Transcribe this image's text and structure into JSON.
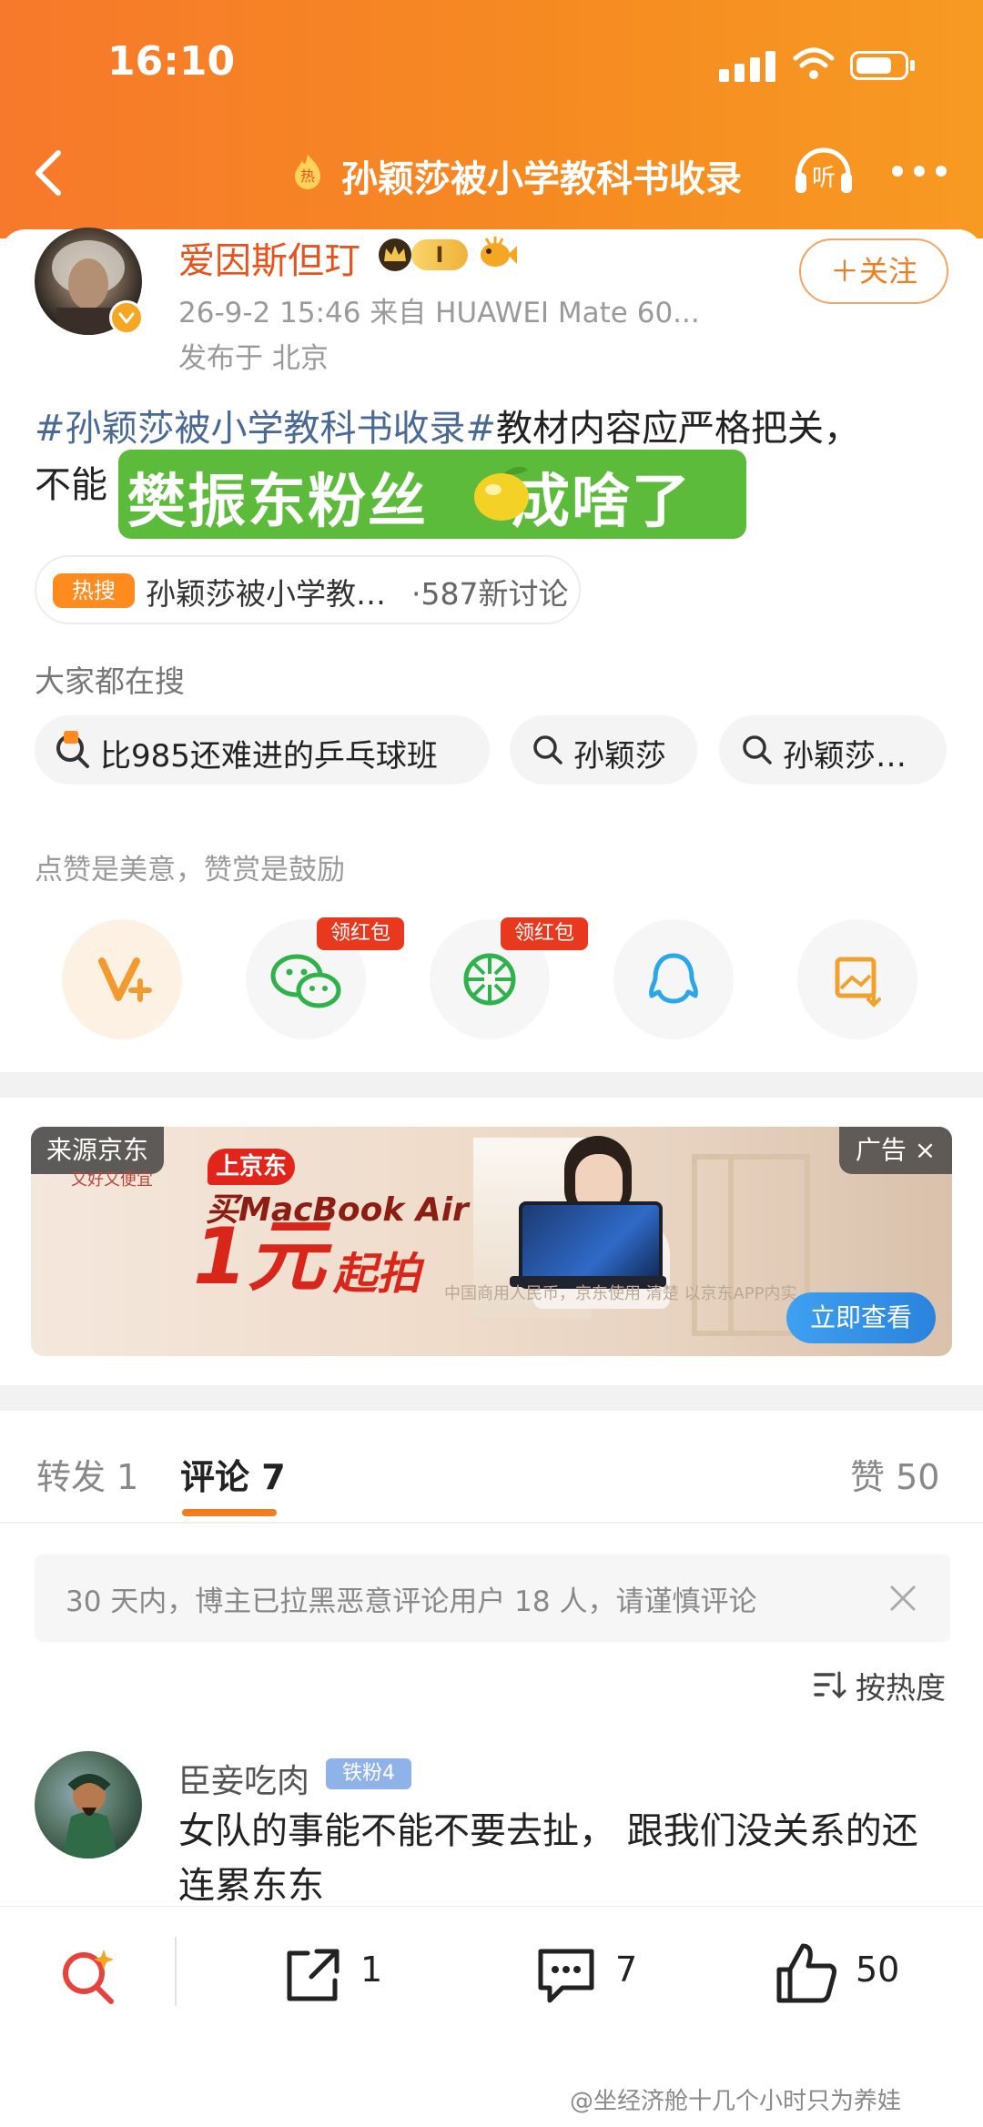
{
  "status_bar": {
    "time": "16:10"
  },
  "header": {
    "title": "孙颖莎被小学教科书收录",
    "hot_icon_text": "热",
    "listen_label": "听",
    "back_icon": "chevron-left-icon",
    "more_icon": "more-dots-icon"
  },
  "post": {
    "author": "爱因斯但玎",
    "level": "I",
    "meta": "26-9-2 15:46  来自 HUAWEI Mate 60...",
    "location": "发布于 北京",
    "follow_label": "＋关注",
    "text_tag": "#孙颖莎被小学教科书收录#",
    "text_body": "教材内容应严格把关，",
    "text_line2": "不能",
    "overlay_left": "樊振东粉丝",
    "overlay_right": "成啥了",
    "hot_search": {
      "badge": "热搜",
      "title": "孙颖莎被小学教…",
      "count": "·587新讨论"
    }
  },
  "search_section": {
    "label": "大家都在搜",
    "items": [
      "比985还难进的乒乓球班",
      "孙颖莎",
      "孙颖莎…"
    ]
  },
  "share_section": {
    "prompt": "点赞是美意，赞赏是鼓励",
    "red_packet_label": "领红包"
  },
  "ad": {
    "source_label": "来源京东",
    "jd_sub": "又好又便宜",
    "ad_label": "广告 ×",
    "jd_logo": "上京东",
    "headline": "买MacBook Air",
    "price": "1元",
    "price_suffix": "起拍",
    "disclaimer": "中国商用人民币，京东使用 清楚 以京东APP内实",
    "cta": "立即查看"
  },
  "comments_section": {
    "tabs": [
      {
        "label": "转发",
        "count": "1"
      },
      {
        "label": "评论",
        "count": "7"
      },
      {
        "label": "赞",
        "count": "50"
      }
    ],
    "notice": "30 天内，博主已拉黑恶意评论用户 18 人，请谨慎评论",
    "sort_label": "按热度",
    "comment": {
      "author": "臣妾吃肉",
      "fan_badge": "铁粉4",
      "text": "女队的事能不能不要去扯， 跟我们没关系的还连累东东"
    }
  },
  "bottom_bar": {
    "repost_count": "1",
    "comment_count": "7",
    "like_count": "50"
  },
  "watermark": "@坐经济舱十几个小时只为养娃",
  "colors": {
    "header_orange": "#f68a22",
    "author_name": "#e8531c",
    "topic_link": "#4a6a96",
    "accent": "#f07d22",
    "red_packet": "#e8391f"
  }
}
